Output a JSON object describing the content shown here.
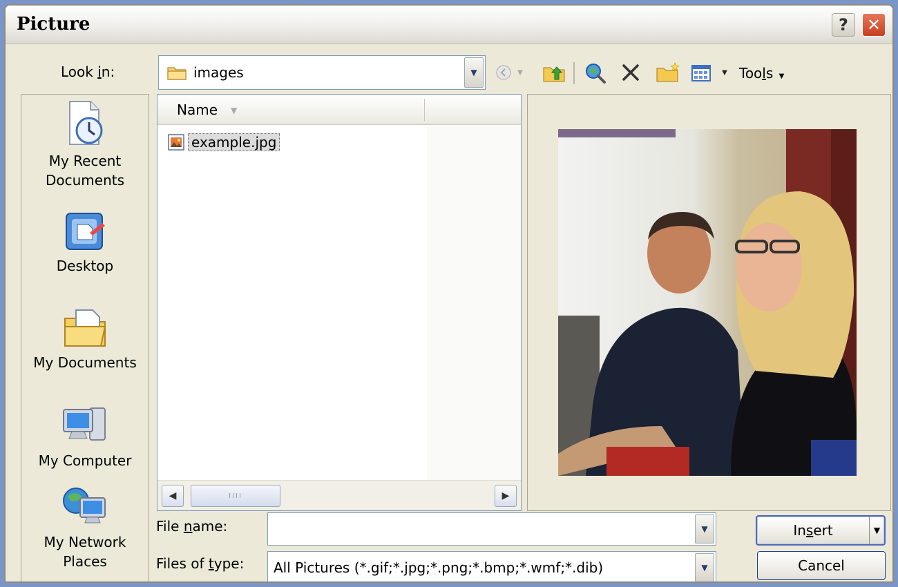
{
  "window": {
    "title": "Picture",
    "help_button": "?",
    "close_button": "✕"
  },
  "look_in": {
    "label_pre": "Look ",
    "label_accel": "i",
    "label_post": "n:",
    "value": "images"
  },
  "toolbar": {
    "tools_pre": "Too",
    "tools_accel": "l",
    "tools_post": "s"
  },
  "places": [
    {
      "label": "My Recent\nDocuments",
      "icon": "recent-documents-icon"
    },
    {
      "label": "Desktop",
      "icon": "desktop-icon"
    },
    {
      "label": "My Documents",
      "icon": "my-documents-icon"
    },
    {
      "label": "My Computer",
      "icon": "my-computer-icon"
    },
    {
      "label": "My Network\nPlaces",
      "icon": "network-places-icon"
    }
  ],
  "file_list": {
    "column_name": "Name",
    "items": [
      {
        "name": "example.jpg",
        "selected": true
      }
    ],
    "scroll_thumb": "IIII"
  },
  "file_name": {
    "label_pre": "File ",
    "label_accel": "n",
    "label_post": "ame:",
    "value": ""
  },
  "files_of_type": {
    "label_pre": "Files of ",
    "label_accel": "t",
    "label_post": "ype:",
    "value": "All Pictures (*.gif;*.jpg;*.png;*.bmp;*.wmf;*.dib)"
  },
  "buttons": {
    "insert_pre": "In",
    "insert_accel": "s",
    "insert_post": "ert",
    "cancel": "Cancel"
  },
  "colors": {
    "dialog_bg": "#ece9d8",
    "border_blue": "#7f9db9",
    "close_red": "#c8401f"
  }
}
